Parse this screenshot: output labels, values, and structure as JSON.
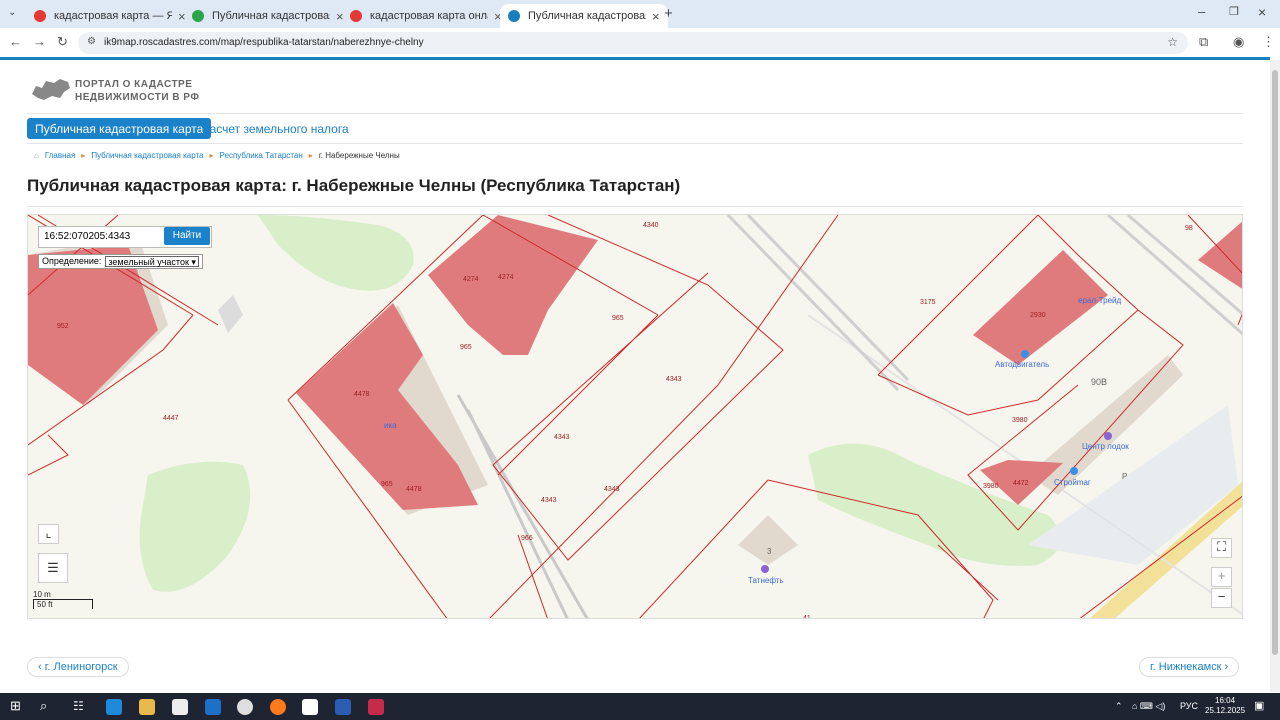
{
  "tabs": [
    {
      "title": "кадастровая карта — Яндекс",
      "color": "#e53935"
    },
    {
      "title": "Публичная кадастровая карта",
      "color": "#2aa64a"
    },
    {
      "title": "кадастровая карта онлайн чел",
      "color": "#e53935"
    },
    {
      "title": "Публичная кадастровая карта",
      "color": "#1a7fbf"
    }
  ],
  "url": "ik9map.roscadastres.com/map/respublika-tatarstan/naberezhnye-chelny",
  "logo": {
    "line1": "ПОРТАЛ О КАДАСТРЕ",
    "line2": "НЕДВИЖИМОСТИ В РФ"
  },
  "nav": {
    "main": "Публичная кадастровая карта",
    "tax": "Расчет земельного налога"
  },
  "breadcrumb": {
    "home": "Главная",
    "map": "Публичная кадастровая карта",
    "region": "Республика Татарстан",
    "current": "г. Набережные Челны"
  },
  "title": "Публичная кадастровая карта: г. Набережные Челны (Республика Татарстан)",
  "search": {
    "value": "16:52:070205:4343",
    "button": "Найти"
  },
  "definition": {
    "label": "Определение:",
    "selected": "земельный участок"
  },
  "scale": {
    "m": "10 m",
    "ft": "50 ft"
  },
  "map_labels": {
    "a": "4340",
    "b": "98",
    "c": "4274",
    "d": "4274",
    "e": "965",
    "f": "965",
    "g": "3175",
    "h": "2930",
    "i": "4343",
    "j": "4343",
    "k": "4343",
    "l": "4343",
    "m": "4447",
    "n": "4478",
    "o": "4478",
    "p": "965",
    "q": "966",
    "r": "3980",
    "s": "3980",
    "t": "4472",
    "u": "90В",
    "v": "3",
    "w": "952",
    "x": "Р",
    "y": "41"
  },
  "pois": {
    "a": "Центр лодок",
    "b": "Стройmаг",
    "c": "Татнефть",
    "d": "Автодвигатель",
    "e": "ерал-Трейд",
    "f": "ика"
  },
  "pager": {
    "prev": "г. Лениногорск",
    "next": "г. Нижнекамск"
  },
  "clock": {
    "time": "16:04",
    "date": "25.12.2025",
    "lang": "РУС"
  }
}
